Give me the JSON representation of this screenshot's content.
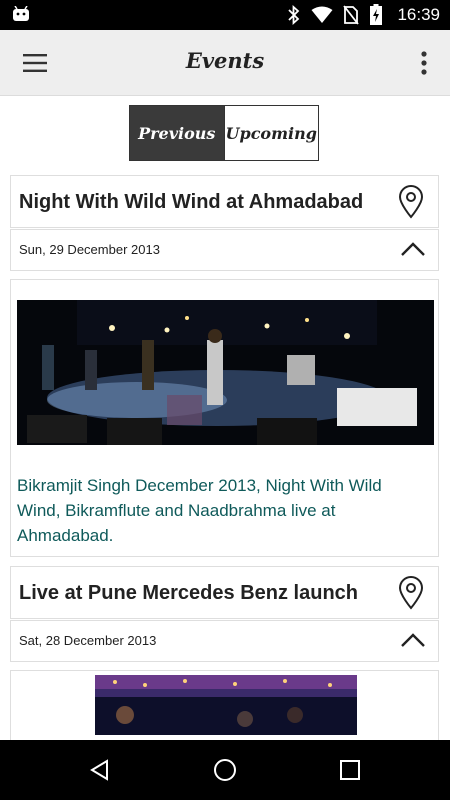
{
  "status_bar": {
    "time": "16:39"
  },
  "app_bar": {
    "title": "Events",
    "menu_icon": "hamburger-menu-icon",
    "overflow_icon": "more-vert-icon"
  },
  "toggle": {
    "previous_label": "Previous",
    "upcoming_label": "Upcoming",
    "selected": "Previous"
  },
  "events": [
    {
      "title": "Night With Wild Wind at Ahmadabad",
      "date": "Sun, 29 December 2013",
      "description": "Bikramjit Singh December 2013, Night With Wild Wind, Bikramflute and Naadbrahma live at Ahmadabad."
    },
    {
      "title": "Live at Pune Mercedes Benz launch",
      "date": "Sat, 28 December 2013"
    }
  ],
  "colors": {
    "description_text": "#0f5a5a",
    "toggle_active_bg": "#3a3a3a",
    "app_bar_bg": "#eeeeee"
  }
}
